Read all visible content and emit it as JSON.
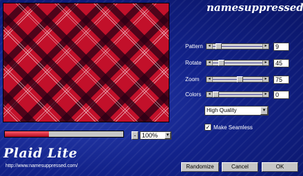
{
  "brand": "namesuppressed",
  "app_title": "Plaid Lite",
  "url": "http://www.namesuppressed.com/",
  "progress": 0.37,
  "zoom": {
    "minus_label": "-",
    "value": "100%",
    "drop_icon": "▾"
  },
  "controls": [
    {
      "label": "Pattern",
      "value": "9",
      "position": 0.07
    },
    {
      "label": "Rotate",
      "value": "45",
      "position": 0.12
    },
    {
      "label": "Zoom",
      "value": "75",
      "position": 0.55
    },
    {
      "label": "Colors",
      "value": "0",
      "position": 0.0
    }
  ],
  "slider_arrows": {
    "left": "◂",
    "right": "▸"
  },
  "quality": {
    "value": "High Quality",
    "drop_icon": "▾"
  },
  "seamless": {
    "checked_mark": "✓",
    "label": "Make Seamless"
  },
  "buttons": {
    "randomize": "Randomize",
    "cancel": "Cancel",
    "ok": "OK"
  },
  "colors": {
    "accent_red": "#c2102a",
    "background_blue": "#12228a"
  }
}
